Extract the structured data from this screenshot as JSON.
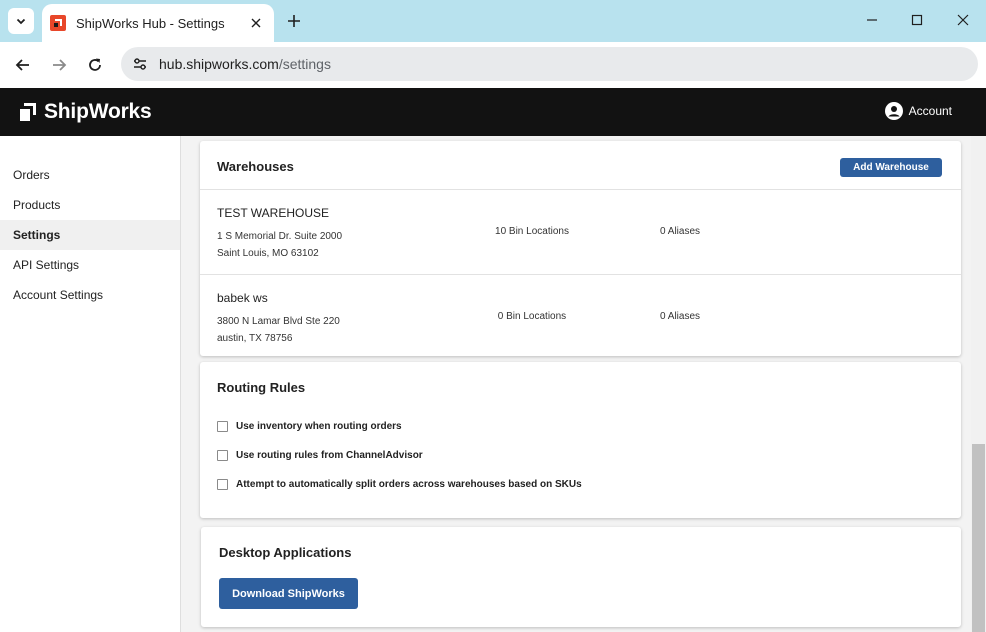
{
  "browser": {
    "tab_title": "ShipWorks Hub - Settings",
    "url_host": "hub.shipworks.com",
    "url_path": "/settings"
  },
  "app": {
    "brand": "ShipWorks",
    "account_label": "Account"
  },
  "sidebar": {
    "items": [
      {
        "label": "Orders",
        "active": false
      },
      {
        "label": "Products",
        "active": false
      },
      {
        "label": "Settings",
        "active": true
      },
      {
        "label": "API Settings",
        "active": false
      },
      {
        "label": "Account Settings",
        "active": false
      }
    ]
  },
  "warehouses": {
    "title": "Warehouses",
    "add_button": "Add Warehouse",
    "items": [
      {
        "name": "TEST WAREHOUSE",
        "address_line1": "1 S Memorial Dr. Suite 2000",
        "address_line2": "Saint Louis, MO 63102",
        "bins": "10 Bin Locations",
        "aliases": "0 Aliases"
      },
      {
        "name": "babek ws",
        "address_line1": "3800 N Lamar Blvd Ste 220",
        "address_line2": "austin, TX 78756",
        "bins": "0 Bin Locations",
        "aliases": "0 Aliases"
      }
    ]
  },
  "routing": {
    "title": "Routing Rules",
    "options": [
      {
        "label": "Use inventory when routing orders",
        "checked": false
      },
      {
        "label": "Use routing rules from ChannelAdvisor",
        "checked": false
      },
      {
        "label": "Attempt to automatically split orders across warehouses based on SKUs",
        "checked": false
      }
    ]
  },
  "desktop": {
    "title": "Desktop Applications",
    "download_button": "Download ShipWorks"
  },
  "colors": {
    "tabbar": "#b8e2ee",
    "appbar": "#121212",
    "primary_button": "#2e5f9e",
    "brand_orange": "#e8472a"
  }
}
